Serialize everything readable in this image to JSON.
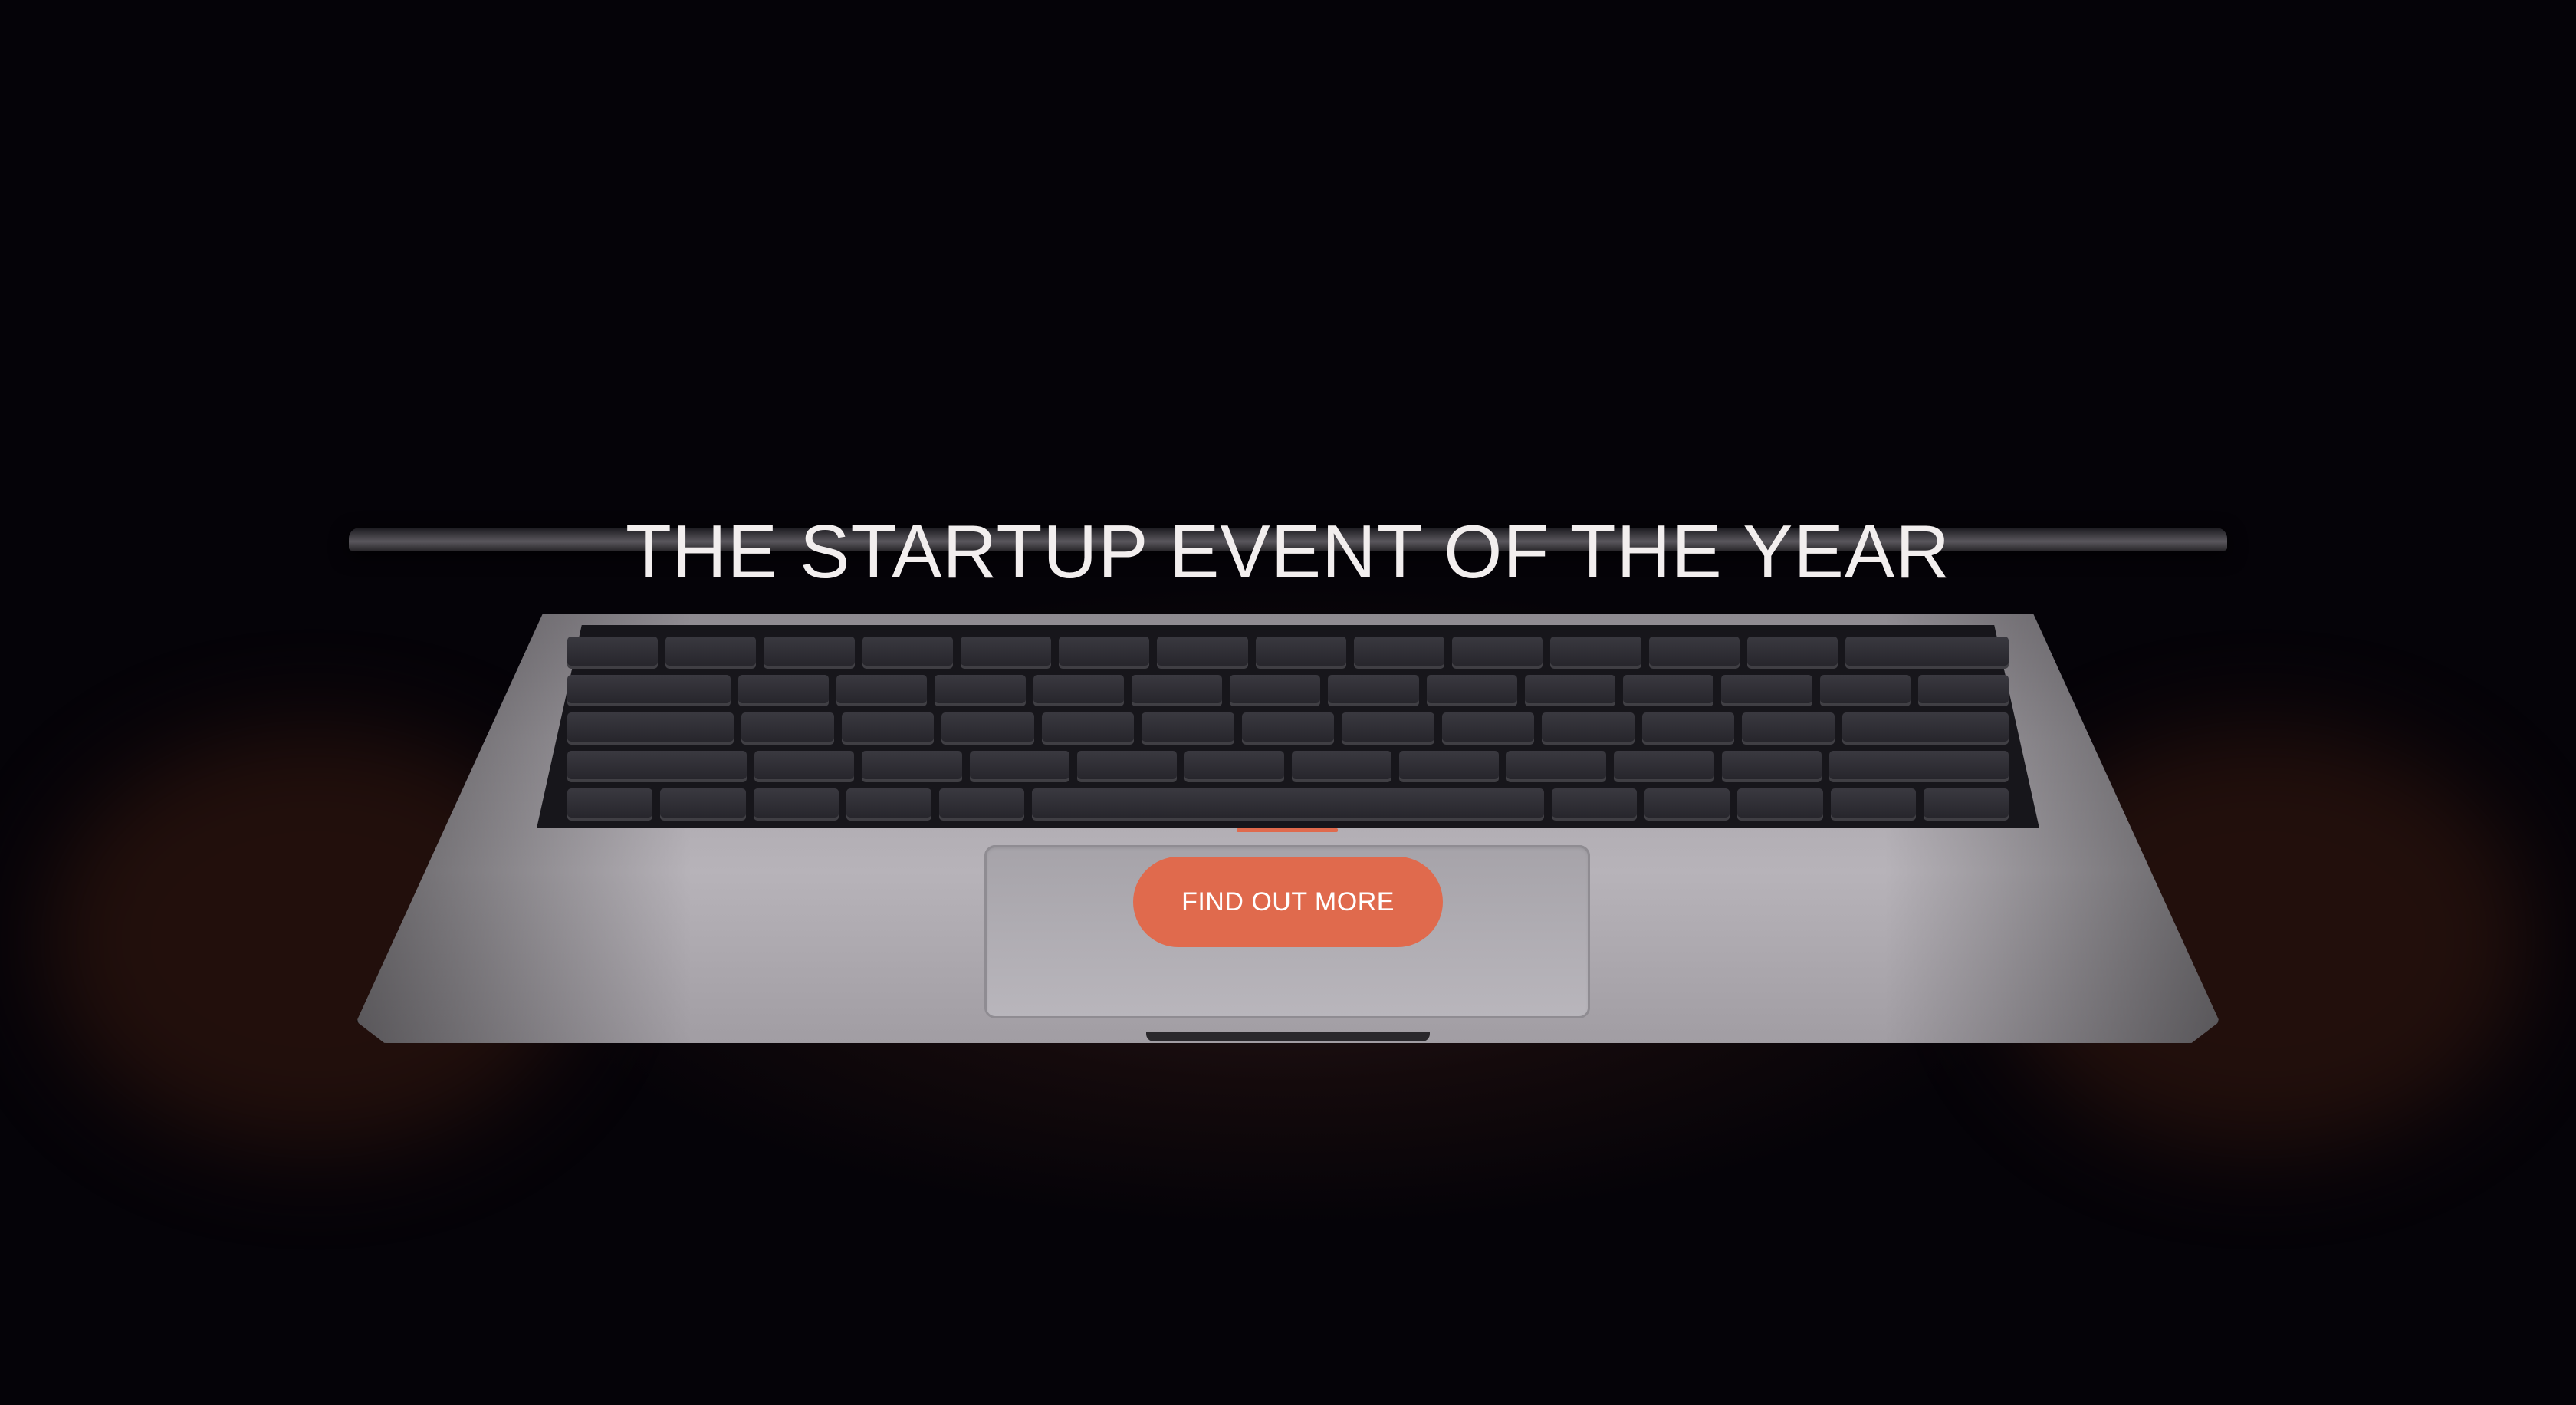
{
  "hero": {
    "headline": "THE STARTUP EVENT OF THE YEAR",
    "cta_label": "FIND OUT MORE",
    "background_image": "laptop-dark-photo"
  },
  "colors": {
    "accent": "#e06a4d",
    "headline_text": "#f2eeee",
    "background": "#050308"
  }
}
